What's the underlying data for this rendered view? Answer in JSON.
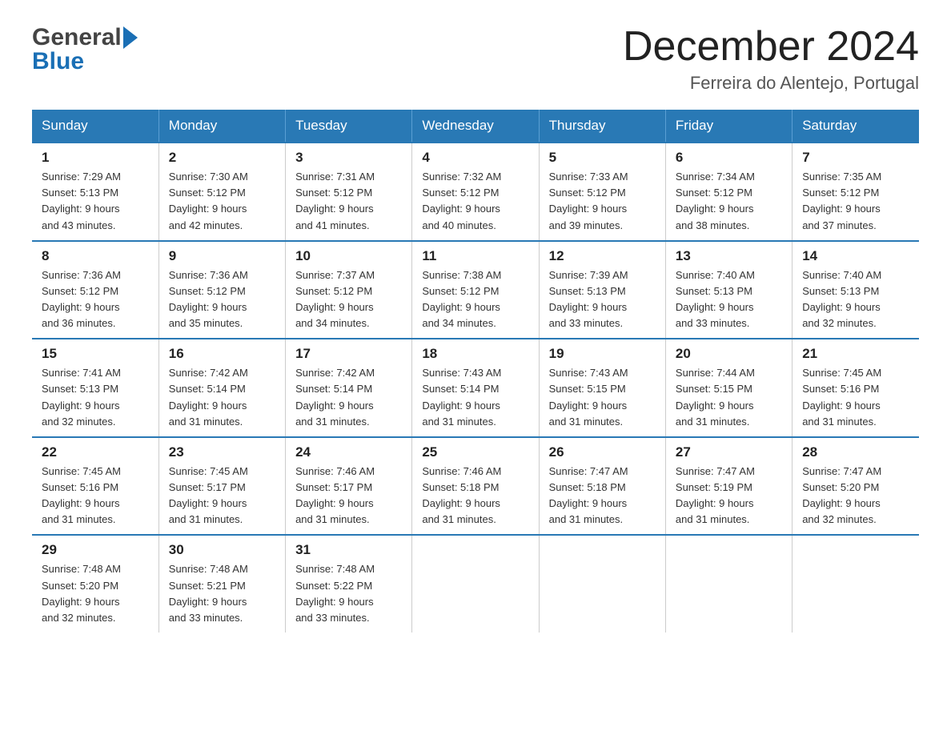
{
  "header": {
    "logo_general": "General",
    "logo_blue": "Blue",
    "title": "December 2024",
    "subtitle": "Ferreira do Alentejo, Portugal"
  },
  "weekdays": [
    "Sunday",
    "Monday",
    "Tuesday",
    "Wednesday",
    "Thursday",
    "Friday",
    "Saturday"
  ],
  "weeks": [
    [
      {
        "day": "1",
        "sunrise": "7:29 AM",
        "sunset": "5:13 PM",
        "daylight": "9 hours and 43 minutes."
      },
      {
        "day": "2",
        "sunrise": "7:30 AM",
        "sunset": "5:12 PM",
        "daylight": "9 hours and 42 minutes."
      },
      {
        "day": "3",
        "sunrise": "7:31 AM",
        "sunset": "5:12 PM",
        "daylight": "9 hours and 41 minutes."
      },
      {
        "day": "4",
        "sunrise": "7:32 AM",
        "sunset": "5:12 PM",
        "daylight": "9 hours and 40 minutes."
      },
      {
        "day": "5",
        "sunrise": "7:33 AM",
        "sunset": "5:12 PM",
        "daylight": "9 hours and 39 minutes."
      },
      {
        "day": "6",
        "sunrise": "7:34 AM",
        "sunset": "5:12 PM",
        "daylight": "9 hours and 38 minutes."
      },
      {
        "day": "7",
        "sunrise": "7:35 AM",
        "sunset": "5:12 PM",
        "daylight": "9 hours and 37 minutes."
      }
    ],
    [
      {
        "day": "8",
        "sunrise": "7:36 AM",
        "sunset": "5:12 PM",
        "daylight": "9 hours and 36 minutes."
      },
      {
        "day": "9",
        "sunrise": "7:36 AM",
        "sunset": "5:12 PM",
        "daylight": "9 hours and 35 minutes."
      },
      {
        "day": "10",
        "sunrise": "7:37 AM",
        "sunset": "5:12 PM",
        "daylight": "9 hours and 34 minutes."
      },
      {
        "day": "11",
        "sunrise": "7:38 AM",
        "sunset": "5:12 PM",
        "daylight": "9 hours and 34 minutes."
      },
      {
        "day": "12",
        "sunrise": "7:39 AM",
        "sunset": "5:13 PM",
        "daylight": "9 hours and 33 minutes."
      },
      {
        "day": "13",
        "sunrise": "7:40 AM",
        "sunset": "5:13 PM",
        "daylight": "9 hours and 33 minutes."
      },
      {
        "day": "14",
        "sunrise": "7:40 AM",
        "sunset": "5:13 PM",
        "daylight": "9 hours and 32 minutes."
      }
    ],
    [
      {
        "day": "15",
        "sunrise": "7:41 AM",
        "sunset": "5:13 PM",
        "daylight": "9 hours and 32 minutes."
      },
      {
        "day": "16",
        "sunrise": "7:42 AM",
        "sunset": "5:14 PM",
        "daylight": "9 hours and 31 minutes."
      },
      {
        "day": "17",
        "sunrise": "7:42 AM",
        "sunset": "5:14 PM",
        "daylight": "9 hours and 31 minutes."
      },
      {
        "day": "18",
        "sunrise": "7:43 AM",
        "sunset": "5:14 PM",
        "daylight": "9 hours and 31 minutes."
      },
      {
        "day": "19",
        "sunrise": "7:43 AM",
        "sunset": "5:15 PM",
        "daylight": "9 hours and 31 minutes."
      },
      {
        "day": "20",
        "sunrise": "7:44 AM",
        "sunset": "5:15 PM",
        "daylight": "9 hours and 31 minutes."
      },
      {
        "day": "21",
        "sunrise": "7:45 AM",
        "sunset": "5:16 PM",
        "daylight": "9 hours and 31 minutes."
      }
    ],
    [
      {
        "day": "22",
        "sunrise": "7:45 AM",
        "sunset": "5:16 PM",
        "daylight": "9 hours and 31 minutes."
      },
      {
        "day": "23",
        "sunrise": "7:45 AM",
        "sunset": "5:17 PM",
        "daylight": "9 hours and 31 minutes."
      },
      {
        "day": "24",
        "sunrise": "7:46 AM",
        "sunset": "5:17 PM",
        "daylight": "9 hours and 31 minutes."
      },
      {
        "day": "25",
        "sunrise": "7:46 AM",
        "sunset": "5:18 PM",
        "daylight": "9 hours and 31 minutes."
      },
      {
        "day": "26",
        "sunrise": "7:47 AM",
        "sunset": "5:18 PM",
        "daylight": "9 hours and 31 minutes."
      },
      {
        "day": "27",
        "sunrise": "7:47 AM",
        "sunset": "5:19 PM",
        "daylight": "9 hours and 31 minutes."
      },
      {
        "day": "28",
        "sunrise": "7:47 AM",
        "sunset": "5:20 PM",
        "daylight": "9 hours and 32 minutes."
      }
    ],
    [
      {
        "day": "29",
        "sunrise": "7:48 AM",
        "sunset": "5:20 PM",
        "daylight": "9 hours and 32 minutes."
      },
      {
        "day": "30",
        "sunrise": "7:48 AM",
        "sunset": "5:21 PM",
        "daylight": "9 hours and 33 minutes."
      },
      {
        "day": "31",
        "sunrise": "7:48 AM",
        "sunset": "5:22 PM",
        "daylight": "9 hours and 33 minutes."
      },
      null,
      null,
      null,
      null
    ]
  ],
  "labels": {
    "sunrise": "Sunrise:",
    "sunset": "Sunset:",
    "daylight": "Daylight:"
  }
}
